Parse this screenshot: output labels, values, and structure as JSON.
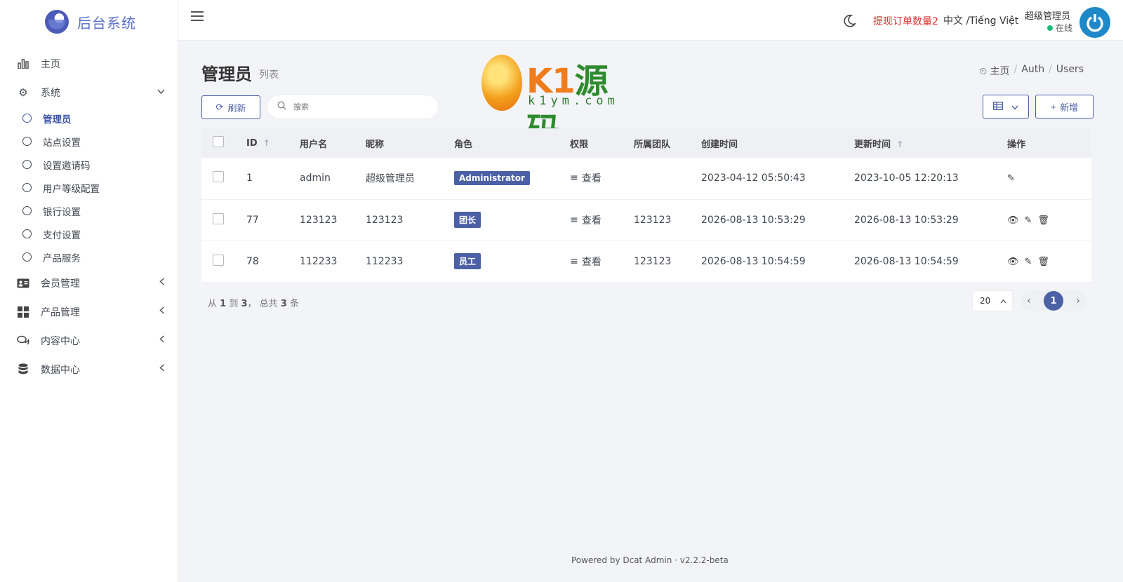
{
  "brand": {
    "name": "后台系统"
  },
  "sidebar": {
    "items": [
      {
        "label": "主页",
        "icon": "bar-chart-icon"
      },
      {
        "label": "系统",
        "icon": "gear-icon"
      },
      {
        "label": "会员管理",
        "icon": "id-card-icon"
      },
      {
        "label": "产品管理",
        "icon": "grid-icon"
      },
      {
        "label": "内容中心",
        "icon": "comments-icon"
      },
      {
        "label": "数据中心",
        "icon": "database-icon"
      }
    ],
    "system_children": [
      "管理员",
      "站点设置",
      "设置邀请码",
      "用户等级配置",
      "银行设置",
      "支付设置",
      "产品服务"
    ]
  },
  "navbar": {
    "withdraw_notice": "提现订单数量2",
    "language": "中文 /Tiếng Việt",
    "user_name": "超级管理员",
    "user_status": "在线"
  },
  "page": {
    "title": "管理员",
    "subtitle": "列表",
    "breadcrumb": [
      "主页",
      "Auth",
      "Users"
    ]
  },
  "watermark": {
    "k": "K1",
    "cn": "源码",
    "url": "k1ym.com"
  },
  "toolbar": {
    "refresh_label": "刷新",
    "search_placeholder": "搜索",
    "new_label": "新增"
  },
  "table": {
    "headers": [
      "ID",
      "用户名",
      "昵称",
      "角色",
      "权限",
      "所属团队",
      "创建时间",
      "更新时间",
      "操作"
    ],
    "rows": [
      {
        "id": "1",
        "username": "admin",
        "nickname": "超级管理员",
        "role": "Administrator",
        "perm": "查看",
        "team": "",
        "created": "2023-04-12 05:50:43",
        "updated": "2023-10-05 12:20:13"
      },
      {
        "id": "77",
        "username": "123123",
        "nickname": "123123",
        "role": "团长",
        "perm": "查看",
        "team": "123123",
        "created": "2026-08-13 10:53:29",
        "updated": "2026-08-13 10:53:29"
      },
      {
        "id": "78",
        "username": "112233",
        "nickname": "112233",
        "role": "员工",
        "perm": "查看",
        "team": "123123",
        "created": "2026-08-13 10:54:59",
        "updated": "2026-08-13 10:54:59"
      }
    ]
  },
  "pagination": {
    "from": "1",
    "to": "3",
    "total": "3",
    "text_from": "从",
    "text_to": "到",
    "text_total": "， 总共",
    "text_unit": "条",
    "per_page": "20",
    "current": "1"
  },
  "footer": {
    "text": "Powered by Dcat Admin  ·  v2.2.2-beta"
  },
  "colors": {
    "accent": "#4c60a6",
    "danger": "#e02f2f",
    "online": "#21b978"
  }
}
